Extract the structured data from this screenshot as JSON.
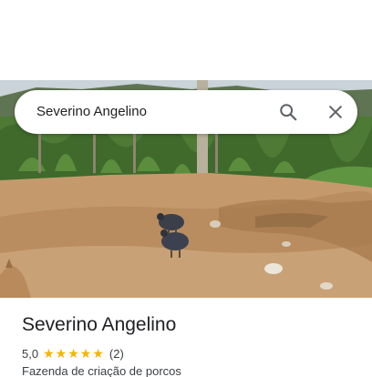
{
  "search": {
    "query": "Severino Angelino",
    "search_icon": "search-icon",
    "close_icon": "close-icon"
  },
  "photo": {
    "icon": "place-photo"
  },
  "place": {
    "name": "Severino Angelino",
    "rating": "5,0",
    "rating_stars": 5,
    "star_color": "#f4b400",
    "review_count": "(2)",
    "category": "Fazenda de criação de porcos"
  }
}
